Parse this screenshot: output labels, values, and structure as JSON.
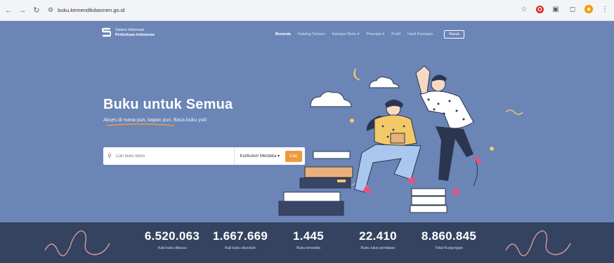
{
  "browser": {
    "url": "buku.kemendikdasmen.go.id",
    "back_icon": "arrow-left-icon",
    "forward_icon": "arrow-right-icon",
    "reload_icon": "reload-icon"
  },
  "site": {
    "logo_line1": "Sistem Informasi",
    "logo_line2": "Perbukuan Indonesia",
    "nav": [
      {
        "label": "Beranda"
      },
      {
        "label": "Katalog Terbaru"
      },
      {
        "label": "Kategori Buku ▾"
      },
      {
        "label": "Petunjuk ▾"
      },
      {
        "label": "Profil"
      },
      {
        "label": "Hasil Penilaian"
      }
    ],
    "login_label": "Masuk"
  },
  "hero": {
    "title": "Buku untuk Semua",
    "subtitle": "Akses di mana pun, kapan pun. Baca buku yuk!",
    "search_placeholder": "Cari buku disini",
    "curriculum": "Kurikulum Merdeka ▾",
    "search_button": "Cari"
  },
  "stats": [
    {
      "value": "6.520.063",
      "label": "Kali buku dibaca"
    },
    {
      "value": "1.667.669",
      "label": "Kali buku diunduh"
    },
    {
      "value": "1.445",
      "label": "Buku tersedia"
    },
    {
      "value": "22.410",
      "label": "Buku lulus penilaian"
    },
    {
      "value": "8.860.845",
      "label": "Total Kunjungan"
    }
  ],
  "colors": {
    "hero_bg": "#6b85b6",
    "stats_bg": "#34435f",
    "accent": "#f09a3e"
  }
}
